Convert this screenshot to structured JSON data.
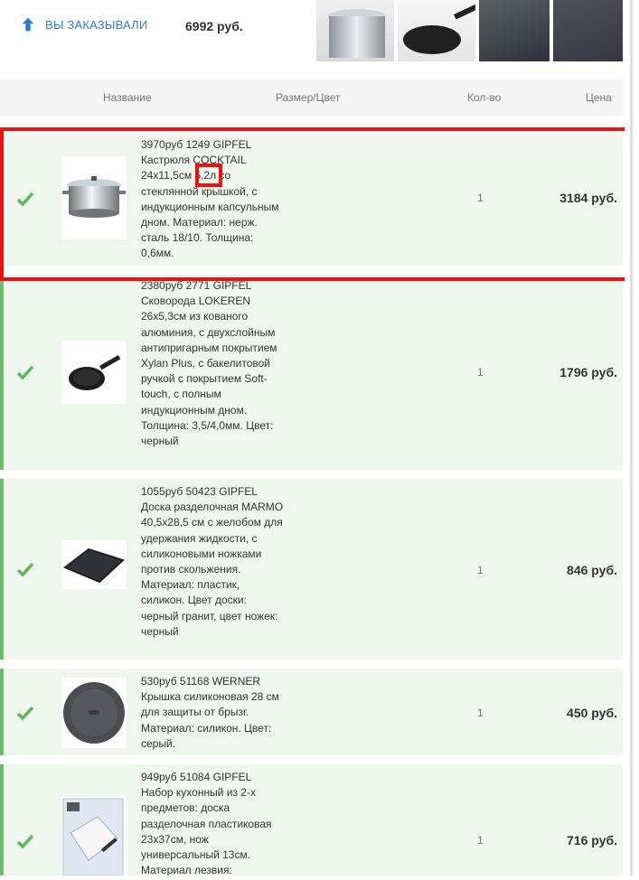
{
  "top": {
    "ordered_label": "ВЫ ЗАКАЗЫВАЛИ",
    "total": "6992 руб."
  },
  "columns": {
    "name": "Название",
    "size": "Размер/Цвет",
    "qty": "Кол-во",
    "price": "Цена"
  },
  "items": [
    {
      "name": "3970руб 1249 GIPFEL\nКастрюля COCKTAIL 24x11,5см 5,2л со стеклянной крышкой, с индукционным капсульным дном. Материал: нерж. сталь 18/10. Толщина: 0,6мм.",
      "qty": "1",
      "price": "3184 руб."
    },
    {
      "name": "2380руб 2771 GIPFEL\nСковорода LOKEREN 26x5,3см из кованого алюминия, с двухслойным антипригарным покрытием Xylan Plus, с бакелитовой ручкой с покрытием Soft-touch, с полным индукционным дном. Толщина: 3,5/4,0мм. Цвет: черный",
      "qty": "1",
      "price": "1796 руб."
    },
    {
      "name": "1055руб 50423 GIPFEL\nДоска разделочная MARMO 40,5x28,5 см с желобом для удержания жидкости, с силиконовыми ножками против скольжения. Материал: пластик, силикон. Цвет доски: черный гранит, цвет ножек: черный",
      "qty": "1",
      "price": "846 руб."
    },
    {
      "name": "530руб 51168 WERNER\nКрышка силиконовая 28 см для защиты от брызг. Материал: силикон. Цвет: серый.",
      "qty": "1",
      "price": "450 руб."
    },
    {
      "name": "949руб 51084 GIPFEL\nНабор кухонный из 2-х предметов: доска разделочная пластиковая 23x37см, нож универсальный 13см. Материал лезвия:",
      "qty": "1",
      "price": "716 руб."
    }
  ],
  "colors": {
    "accent": "#2b7bd6",
    "row_bg": "#eef6ee",
    "check": "#5cb85c",
    "highlight": "#ee1111"
  }
}
